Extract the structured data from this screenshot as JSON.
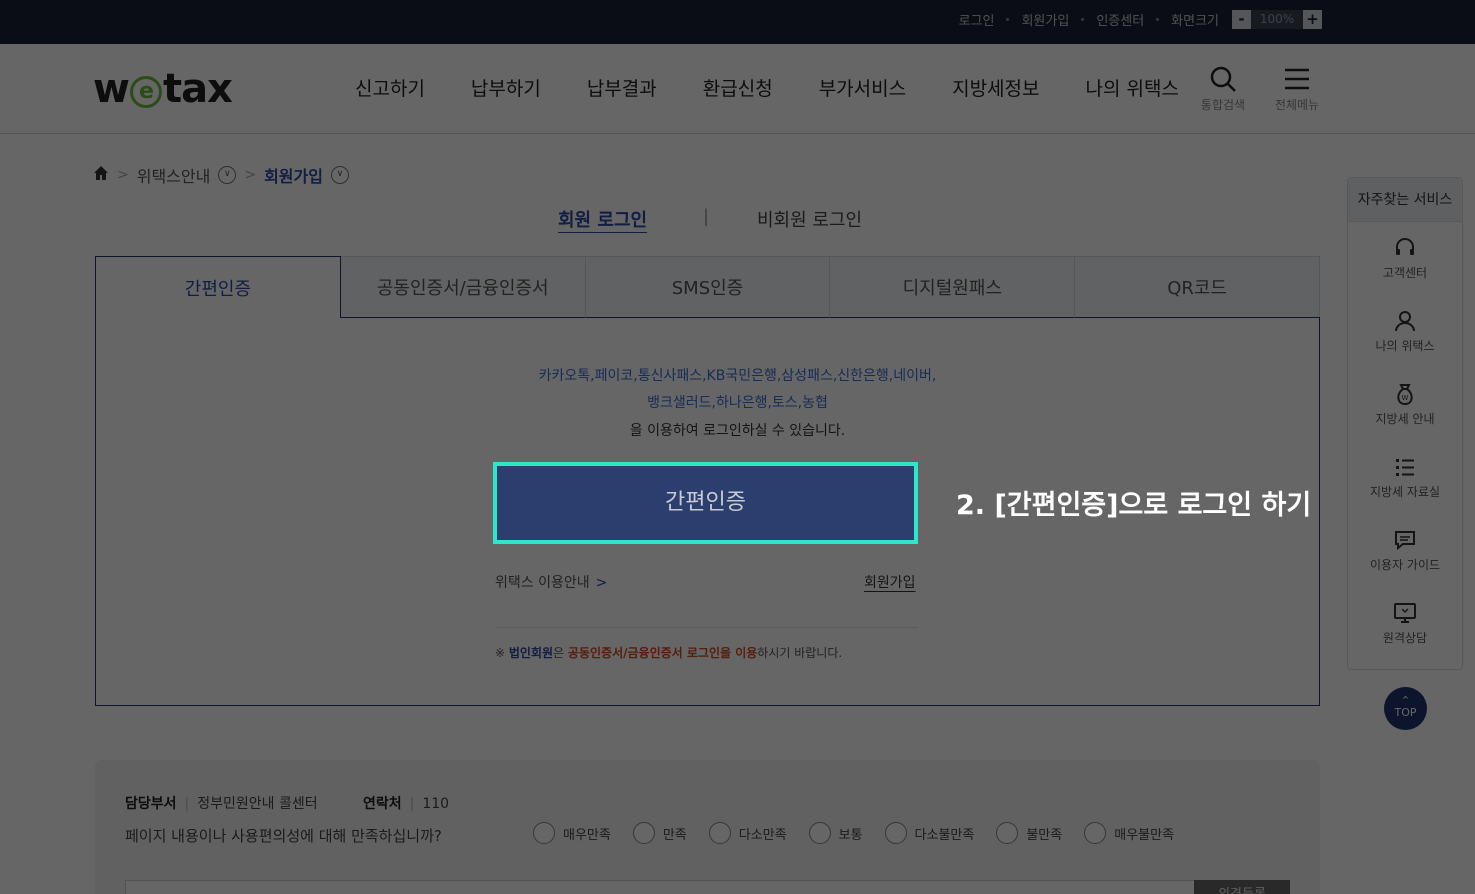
{
  "util": {
    "links": [
      "로그인",
      "회원가입",
      "인증센터",
      "화면크기"
    ],
    "zoom_minus": "-",
    "zoom_value": "100%",
    "zoom_plus": "+"
  },
  "header": {
    "logo_pre": "w",
    "logo_e": "e",
    "logo_post": "tax",
    "menu": [
      "신고하기",
      "납부하기",
      "납부결과",
      "환급신청",
      "부가서비스",
      "지방세정보",
      "나의 위택스"
    ],
    "search_label": "통합검색",
    "allmenu_label": "전체메뉴"
  },
  "breadcrumb": {
    "level1": "위택스안내",
    "level2": "회원가입"
  },
  "login_type": {
    "member": "회원 로그인",
    "divider": "|",
    "nonmember": "비회원 로그인"
  },
  "tabs": [
    "간편인증",
    "공동인증서/금융인증서",
    "SMS인증",
    "디지털원패스",
    "QR코드"
  ],
  "content": {
    "providers_line1": "카카오톡,페이코,통신사패스,KB국민은행,삼성패스,신한은행,네이버,",
    "providers_line2": "뱅크샐러드,하나은행,토스,농협",
    "providers_line3": "을 이용하여 로그인하실 수 있습니다.",
    "auth_button": "간편인증",
    "guide_link": "위택스 이용안내",
    "guide_arrow": ">",
    "join_link": "회원가입",
    "note_mark": "※ ",
    "note_corp": "법인회원",
    "note_mid": "은 ",
    "note_cert": "공동인증서/금융인증서 로그인을 이용",
    "note_end": "하시기 바랍니다."
  },
  "callout": "2. [간편인증]으로 로그인 하기",
  "quick_menu": {
    "title": "자주찾는 서비스",
    "items": [
      "고객센터",
      "나의 위택스",
      "지방세 안내",
      "지방세 자료실",
      "이용자 가이드",
      "원격상담"
    ]
  },
  "top_button": "TOP",
  "survey": {
    "dept_label": "담당부서",
    "dept_value": "정부민원안내 콜센터",
    "contact_label": "연락처",
    "contact_value": "110",
    "question": "페이지 내용이나 사용편의성에 대해 만족하십니까?",
    "options": [
      "매우만족",
      "만족",
      "다소만족",
      "보통",
      "다소불만족",
      "불만족",
      "매우불만족"
    ],
    "submit": "의견등록"
  },
  "colors": {
    "navy": "#1f3572",
    "accent_blue": "#2b4aa8",
    "highlight": "#2ee6c8",
    "topbar": "#1a2236"
  }
}
